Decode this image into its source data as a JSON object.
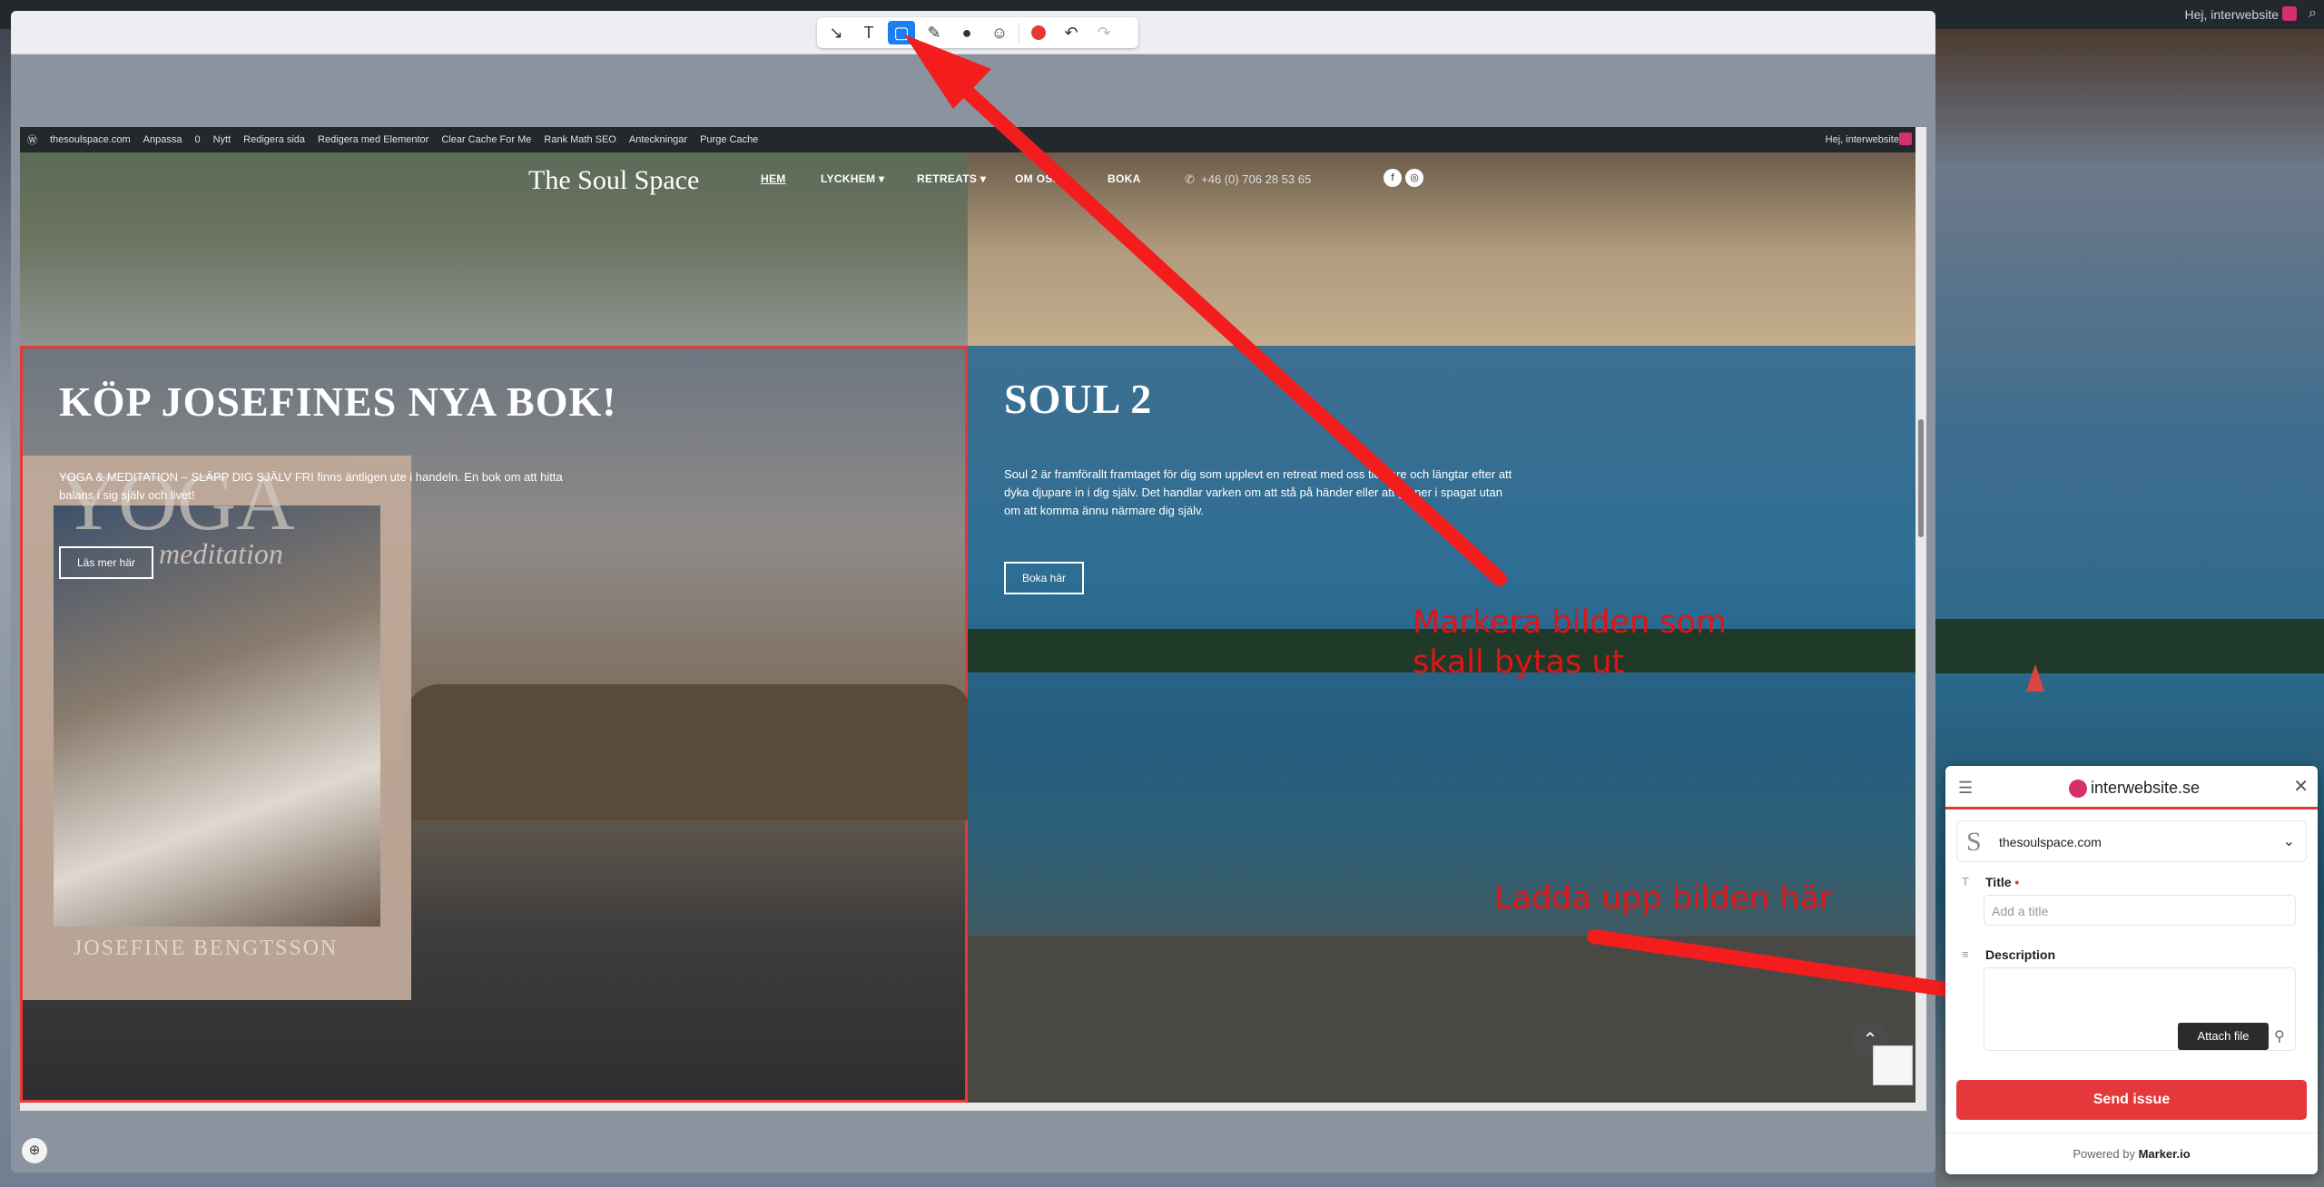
{
  "outer_bar": {
    "greeting": "Hej, interwebsite"
  },
  "toolbar": {
    "tools": [
      "arrow-tool",
      "text-tool",
      "rectangle-tool",
      "pen-tool",
      "blur-tool",
      "emoji-tool",
      "record-tool",
      "undo",
      "redo"
    ],
    "active": "rectangle-tool"
  },
  "wp_admin_bar": {
    "items": [
      "thesoulspace.com",
      "Anpassa",
      "0",
      "Nytt",
      "Redigera sida",
      "Redigera med Elementor",
      "Clear Cache For Me",
      "Rank Math SEO",
      "Anteckningar",
      "Purge Cache"
    ],
    "greeting": "Hej, interwebsite"
  },
  "site_header": {
    "logo": "The Soul Space",
    "nav": [
      "HEM",
      "LYCKHEM ▾",
      "RETREATS ▾",
      "OM OSS",
      "BOKA"
    ],
    "phone": "+46 (0) 706 28 53 65"
  },
  "panel_left": {
    "title": "KÖP JOSEFINES NYA BOK!",
    "text": "YOGA & MEDITATION – SLÄPP DIG SJÄLV FRI finns äntligen ute i handeln. En bok om att hitta balans i sig själv och livet!",
    "button": "Läs mer här",
    "book_title": "YOGA",
    "book_subtitle": "meditation",
    "book_author": "JOSEFINE BENGTSSON"
  },
  "panel_right": {
    "title": "SOUL 2",
    "text": "Soul 2 är framförallt framtaget för dig som upplevt en retreat med oss tidigare och längtar efter att dyka djupare in i dig själv. Det handlar varken om att stå på händer eller att gå ner i spagat utan om att komma ännu närmare dig själv.",
    "button": "Boka här"
  },
  "annotations": {
    "first": "Markera bilden som skall bytas ut",
    "second": "Ladda upp bilden här"
  },
  "widget": {
    "brand": "interwebsite.se",
    "site": "thesoulspace.com",
    "title_label": "Title",
    "title_placeholder": "Add a title",
    "description_label": "Description",
    "attach_tooltip": "Attach file",
    "send_button": "Send issue",
    "powered_prefix": "Powered by ",
    "powered_brand": "Marker.io"
  },
  "colors": {
    "accent_red": "#e53935",
    "active_tool_blue": "#1c7ef0"
  }
}
